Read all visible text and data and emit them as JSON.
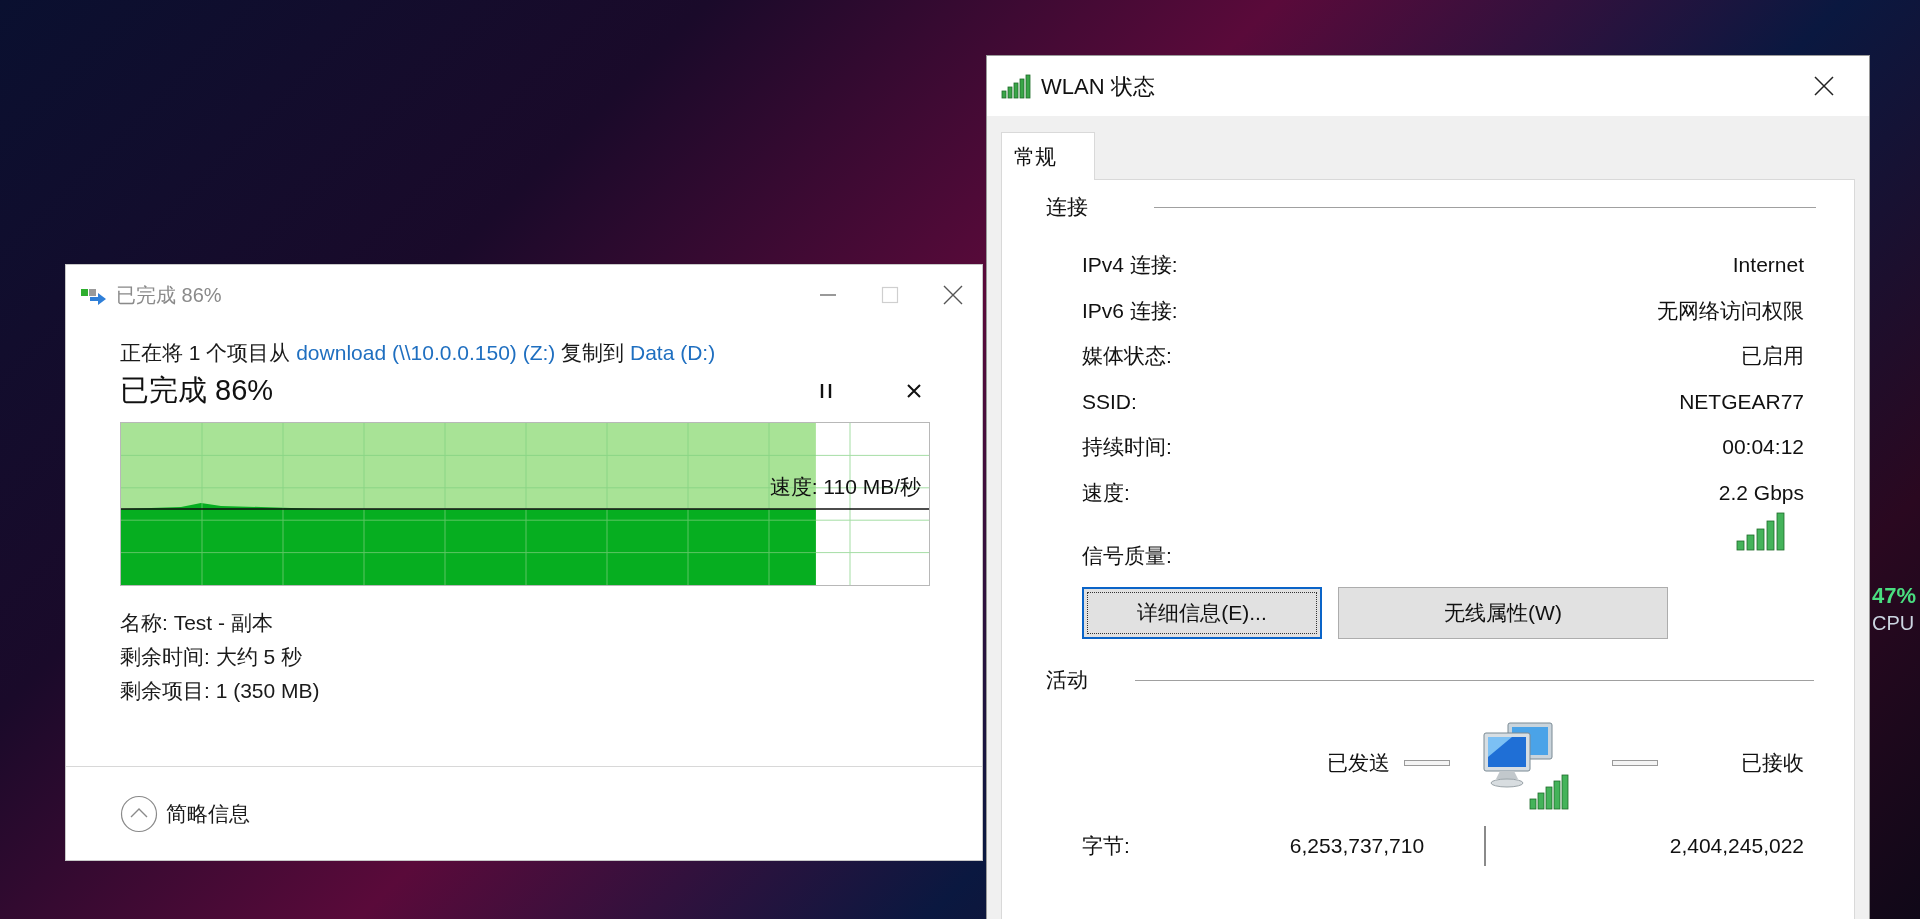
{
  "desktop": {
    "widget": {
      "value": "47%",
      "label": "CPU"
    }
  },
  "copy_dialog": {
    "title": "已完成 86%",
    "description": [
      {
        "kind": "plain",
        "text": "正在将 1 个项目从 "
      },
      {
        "kind": "link",
        "text": "download (\\\\10.0.0.150) (Z:)"
      },
      {
        "kind": "plain",
        "text": " 复制到 "
      },
      {
        "kind": "link",
        "text": "Data (D:)"
      }
    ],
    "heading": "已完成 86%",
    "graph": {
      "level": 0.86,
      "speed": "速度: 110 MB/秒"
    },
    "details": [
      "名称: Test - 副本",
      "剩余时间: 大约 5 秒",
      "剩余项目: 1 (350 MB)"
    ],
    "footer_toggle": "简略信息"
  },
  "wlan_window": {
    "title": "WLAN 状态",
    "tabs": [
      {
        "label": "常规",
        "selected": true
      }
    ],
    "connection": {
      "title": "连接",
      "rows": [
        {
          "label": "IPv4 连接:",
          "value": "Internet"
        },
        {
          "label": "IPv6 连接:",
          "value": "无网络访问权限"
        },
        {
          "label": "媒体状态:",
          "value": "已启用"
        },
        {
          "label": "SSID:",
          "value": "NETGEAR77"
        },
        {
          "label": "持续时间:",
          "value": "00:04:12"
        },
        {
          "label": "速度:",
          "value": "2.2 Gbps"
        }
      ],
      "signal_label": "信号质量:"
    },
    "buttons": [
      {
        "label": "详细信息(E)...",
        "focused": true
      },
      {
        "label": "无线属性(W)",
        "focused": false
      }
    ],
    "activity": {
      "title": "活动",
      "sent_label": "已发送",
      "received_label": "已接收",
      "bytes_label": "字节:",
      "bytes_sent": "6,253,737,710",
      "bytes_received": "2,404,245,022"
    }
  }
}
